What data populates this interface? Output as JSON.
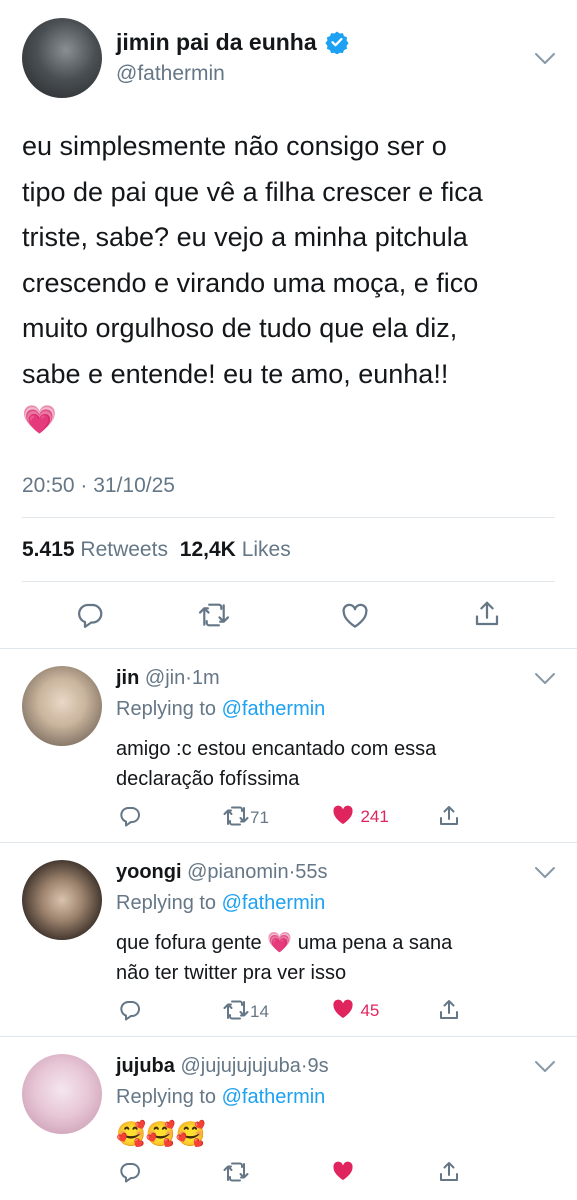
{
  "tweet": {
    "display_name": "jimin pai da eunha",
    "handle": "@fathermin",
    "text_lines": [
      "eu simplesmente não consigo ser o",
      "tipo de pai que vê a filha crescer e fica",
      "triste, sabe? eu vejo a minha pitchula",
      "crescendo e virando uma moça, e fico",
      "muito orgulhoso de tudo que ela diz,",
      "sabe e entende! eu te amo, eunha!!"
    ],
    "emoji": "💗",
    "timestamp": "20:50 · 31/10/25",
    "retweets_count": "5.415",
    "retweets_label": "Retweets",
    "likes_count": "12,4K",
    "likes_label": "Likes",
    "verified": true
  },
  "replies": [
    {
      "name": "jin",
      "handle": "@jin",
      "time": "1m",
      "replying_label": "Replying to",
      "replying_to": "@fathermin",
      "text_lines": [
        "amigo :c estou encantado com essa",
        "declaração fofíssima"
      ],
      "retweets": "71",
      "likes": "241",
      "liked": true
    },
    {
      "name": "yoongi",
      "handle": "@pianomin",
      "time": "55s",
      "replying_label": "Replying to",
      "replying_to": "@fathermin",
      "text_lines": [
        "que fofura gente 💗 uma pena a sana",
        "não ter twitter pra ver isso"
      ],
      "retweets": "14",
      "likes": "45",
      "liked": true
    },
    {
      "name": "jujuba",
      "handle": "@jujujujujuba",
      "time": "9s",
      "replying_label": "Replying to",
      "replying_to": "@fathermin",
      "text_lines": [
        "🥰🥰🥰"
      ],
      "retweets": "",
      "likes": "",
      "liked": true
    }
  ],
  "colors": {
    "accent": "#1da1f2",
    "like_red": "#e0245e",
    "text": "#14171a",
    "secondary": "#657786"
  },
  "icons": [
    "verified-badge-icon",
    "chevron-down-icon",
    "reply-icon",
    "retweet-icon",
    "like-icon",
    "share-icon"
  ]
}
